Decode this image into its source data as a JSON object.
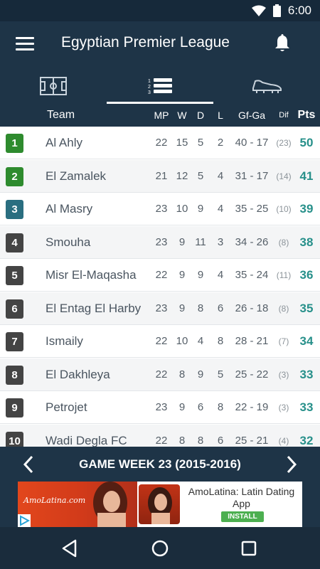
{
  "status_bar": {
    "time": "6:00"
  },
  "app_bar": {
    "title": "Egyptian Premier League"
  },
  "tabs": [
    {
      "name": "field",
      "icon": "soccer-field-icon"
    },
    {
      "name": "standings",
      "icon": "standings-list-icon",
      "active": true
    },
    {
      "name": "boots",
      "icon": "football-boot-icon"
    }
  ],
  "table": {
    "headers": {
      "team": "Team",
      "mp": "MP",
      "w": "W",
      "d": "D",
      "l": "L",
      "gfga": "Gf-Ga",
      "dif": "Dif",
      "pts": "Pts"
    },
    "rows": [
      {
        "pos": "1",
        "team": "Al Ahly",
        "mp": "22",
        "w": "15",
        "d": "5",
        "l": "2",
        "gfga": "40 - 17",
        "dif": "(23)",
        "pts": "50",
        "color": "#2e8b2e"
      },
      {
        "pos": "2",
        "team": "El Zamalek",
        "mp": "21",
        "w": "12",
        "d": "5",
        "l": "4",
        "gfga": "31 - 17",
        "dif": "(14)",
        "pts": "41",
        "color": "#2e8b2e"
      },
      {
        "pos": "3",
        "team": "Al Masry",
        "mp": "23",
        "w": "10",
        "d": "9",
        "l": "4",
        "gfga": "35 - 25",
        "dif": "(10)",
        "pts": "39",
        "color": "#2a6e80"
      },
      {
        "pos": "4",
        "team": "Smouha",
        "mp": "23",
        "w": "9",
        "d": "11",
        "l": "3",
        "gfga": "34 - 26",
        "dif": "(8)",
        "pts": "38",
        "color": "#444444"
      },
      {
        "pos": "5",
        "team": "Misr El-Maqasha",
        "mp": "22",
        "w": "9",
        "d": "9",
        "l": "4",
        "gfga": "35 - 24",
        "dif": "(11)",
        "pts": "36",
        "color": "#444444"
      },
      {
        "pos": "6",
        "team": "El Entag El Harby",
        "mp": "23",
        "w": "9",
        "d": "8",
        "l": "6",
        "gfga": "26 - 18",
        "dif": "(8)",
        "pts": "35",
        "color": "#444444"
      },
      {
        "pos": "7",
        "team": "Ismaily",
        "mp": "22",
        "w": "10",
        "d": "4",
        "l": "8",
        "gfga": "28 - 21",
        "dif": "(7)",
        "pts": "34",
        "color": "#444444"
      },
      {
        "pos": "8",
        "team": "El Dakhleya",
        "mp": "22",
        "w": "8",
        "d": "9",
        "l": "5",
        "gfga": "25 - 22",
        "dif": "(3)",
        "pts": "33",
        "color": "#444444"
      },
      {
        "pos": "9",
        "team": "Petrojet",
        "mp": "23",
        "w": "9",
        "d": "6",
        "l": "8",
        "gfga": "22 - 19",
        "dif": "(3)",
        "pts": "33",
        "color": "#444444"
      },
      {
        "pos": "10",
        "team": "Wadi Degla FC",
        "mp": "22",
        "w": "8",
        "d": "8",
        "l": "6",
        "gfga": "25 - 21",
        "dif": "(4)",
        "pts": "32",
        "color": "#444444"
      }
    ]
  },
  "game_week": {
    "label": "GAME WEEK 23 (2015-2016)"
  },
  "ad": {
    "brand": "AmoLatina.com",
    "title": "AmoLatina: Latin Dating App",
    "install_label": "INSTALL"
  }
}
